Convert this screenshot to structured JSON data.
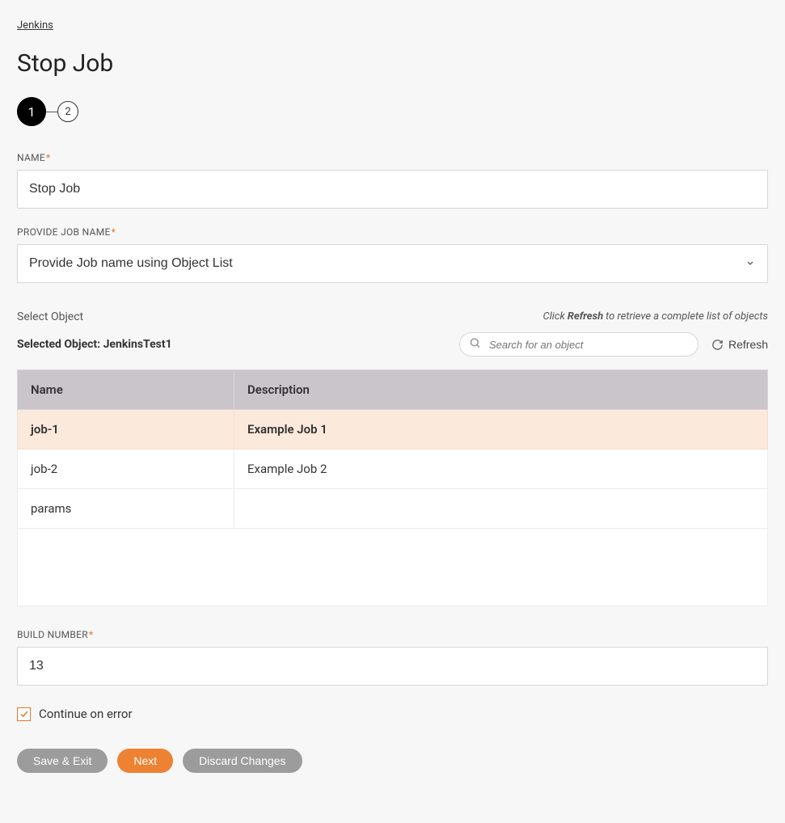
{
  "breadcrumb": {
    "label": "Jenkins"
  },
  "page": {
    "title": "Stop Job"
  },
  "stepper": {
    "current": "1",
    "next": "2"
  },
  "fields": {
    "name": {
      "label": "NAME",
      "value": "Stop Job"
    },
    "provideJob": {
      "label": "PROVIDE JOB NAME",
      "value": "Provide Job name using Object List"
    },
    "buildNumber": {
      "label": "BUILD NUMBER",
      "value": "13"
    }
  },
  "objectSection": {
    "heading": "Select Object",
    "hintPrefix": "Click",
    "hintBold": "Refresh",
    "hintSuffix": "to retrieve a complete list of objects",
    "selectedLabel": "Selected Object: JenkinsTest1",
    "searchPlaceholder": "Search for an object",
    "refreshLabel": "Refresh"
  },
  "table": {
    "headers": {
      "name": "Name",
      "description": "Description"
    },
    "rows": [
      {
        "name": "job-1",
        "description": "Example Job 1",
        "selected": true
      },
      {
        "name": "job-2",
        "description": "Example Job 2",
        "selected": false
      },
      {
        "name": "params",
        "description": "",
        "selected": false
      }
    ]
  },
  "checkbox": {
    "label": "Continue on error",
    "checked": true
  },
  "buttons": {
    "saveExit": "Save & Exit",
    "next": "Next",
    "discard": "Discard Changes"
  }
}
